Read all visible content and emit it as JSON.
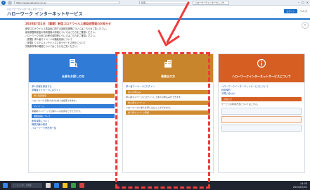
{
  "browser": {
    "url": "https://www.hellowork.go.jp/",
    "search_placeholder": "検索...",
    "tab_title": "ハローワークインターネットサ..."
  },
  "site": {
    "logo_sub": "ハローワークインターネットサービス",
    "logo_main": "ハローワーク インターネットサービス",
    "header_links": [
      "ログイン",
      "ヘルプ"
    ]
  },
  "notice": {
    "title": "2020年7月1日 【重要】新型コロナウイルス感染症関連のお知らせ",
    "lines": [
      "新型コロナウイルス感染症に関する各種支援策についてはこちらをご覧ください。",
      "雇用調整助成金の特例措置の詳細についてはこちらをご確認ください。",
      "ハローワークの窓口の受付時間等についてはこちらをご確認ください。",
      "【重要】求人者マイページの機能改善について",
      "【重要】システムメンテナンスに伴うサービス停止について",
      "労働条件等の確認についてはこちらをご覧ください。"
    ]
  },
  "panels": {
    "jobseeker": {
      "title": "仕事をお探しの方",
      "links": [
        "求人情報を検索する",
        "求職者マイページにログイン"
      ],
      "bars": [
        "求人情報検索",
        "マイページ",
        "職業訓練について"
      ],
      "texts": [
        "ハローワークで受け付けた求人を検索できます。",
        "求職者マイページでは求人への応募などができます。"
      ],
      "extra_links": [
        "雇用保険について",
        "職業訓練の案内",
        "ハローワーク所在地一覧"
      ]
    },
    "employer": {
      "title": "事業主の方",
      "links": [
        "求人者マイページにログイン"
      ],
      "bars": [
        "求人の申込み",
        "求人者マイページ",
        "求人者マイページ登録"
      ],
      "texts": [
        "求人者マイページにログインして求人の申込みができます。",
        "ハローワークに求人を申し込むことができます。"
      ]
    },
    "other": {
      "title": "ハローワークインターネットサービスについて",
      "links": [
        "ハローワークインターネットサービスについて",
        "利用規約",
        "お問い合わせ"
      ],
      "bars": [
        "お知らせ"
      ],
      "texts": [
        "サービスの利用方法についてはこちら。"
      ]
    }
  },
  "taskbar": {
    "search_text": "ここに入力して検索",
    "time": "14:35",
    "date": "2020/07/01"
  },
  "colors": {
    "jobseeker": "#2f7bd6",
    "employer": "#c9852c",
    "other": "#d65e22",
    "highlight": "#ef3b3b"
  }
}
